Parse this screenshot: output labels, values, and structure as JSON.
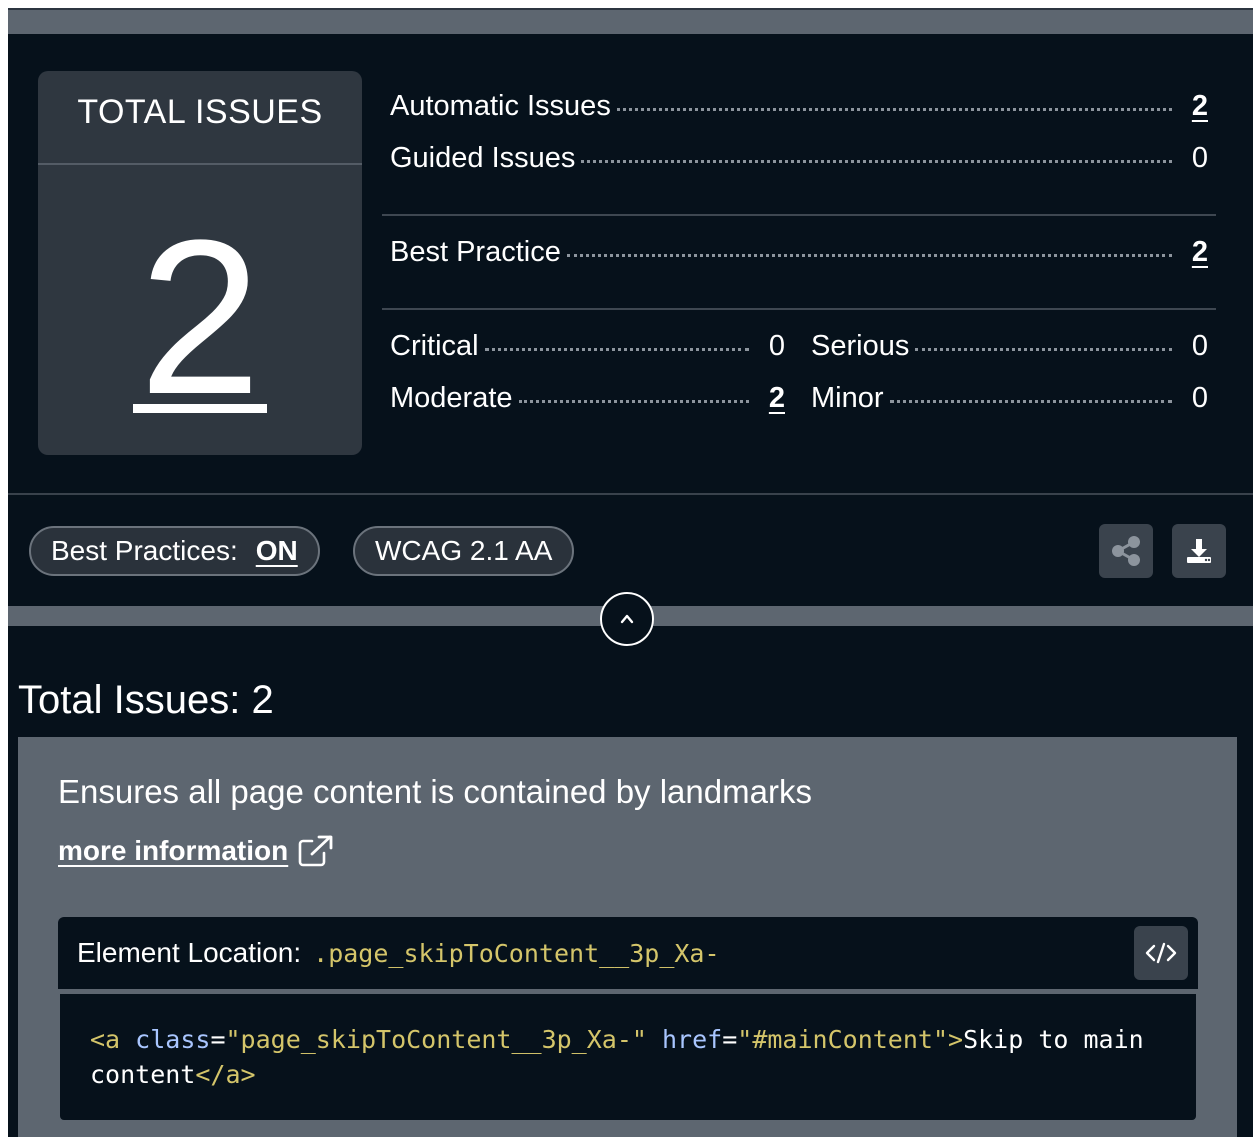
{
  "summary": {
    "total_label": "TOTAL ISSUES",
    "total_value": "2",
    "automatic": {
      "label": "Automatic Issues",
      "value": "2"
    },
    "guided": {
      "label": "Guided Issues",
      "value": "0"
    },
    "best_practice": {
      "label": "Best Practice",
      "value": "2"
    },
    "critical": {
      "label": "Critical",
      "value": "0"
    },
    "serious": {
      "label": "Serious",
      "value": "0"
    },
    "moderate": {
      "label": "Moderate",
      "value": "2"
    },
    "minor": {
      "label": "Minor",
      "value": "0"
    }
  },
  "filters": {
    "best_practices_label": "Best Practices:",
    "best_practices_state": "ON",
    "standard": "WCAG 2.1 AA"
  },
  "toolbar": {
    "share_icon": "share-icon",
    "export_icon": "download-icon",
    "collapse_icon": "chevron-up-icon"
  },
  "issues": {
    "title": "Total Issues: 2",
    "items": [
      {
        "description": "Ensures all page content is contained by landmarks",
        "more_info": "more information",
        "location_label": "Element Location:",
        "selector": ".page_skipToContent__3p_Xa-",
        "source": {
          "open_tag_start": "<a",
          "attr1_name": "class",
          "attr1_eq": "=",
          "attr1_value": "\"page_skipToContent__3p_Xa-\"",
          "attr2_name": "href",
          "attr2_eq": "=",
          "attr2_value": "\"#mainContent\"",
          "open_tag_end": ">",
          "text": "Skip to main content",
          "close_tag": "</a>"
        }
      }
    ]
  },
  "colors": {
    "background": "#06111b",
    "card": "#2f3740",
    "panel": "#5d6670",
    "code_accent": "#d4c56a",
    "code_attr": "#a9c6ff"
  }
}
